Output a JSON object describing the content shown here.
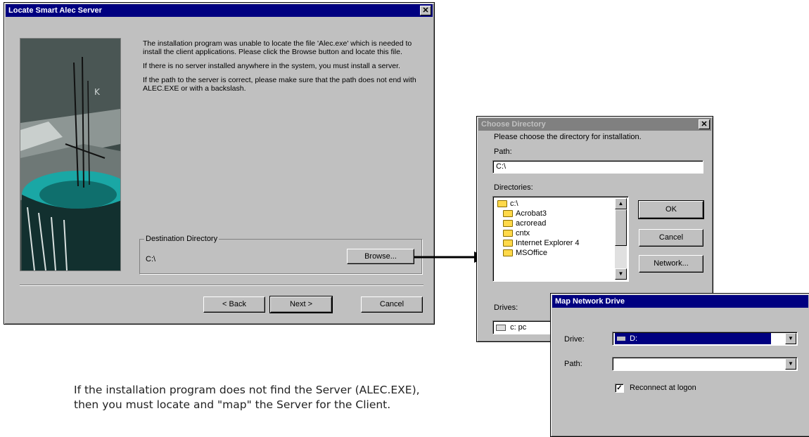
{
  "locate_dialog": {
    "title": "Locate Smart Alec Server",
    "paragraphs": [
      "The installation program was unable to locate the file 'Alec.exe' which is needed to install the client applications.  Please click the Browse button and locate this file.",
      "If there is no server installed anywhere in the system, you must install a server.",
      "If the path to the server is correct, please make sure that the path does not end with ALEC.EXE or with a backslash."
    ],
    "destination_group_label": "Destination Directory",
    "destination_value": "C:\\",
    "browse_label": "Browse...",
    "back_label": "< Back",
    "next_label": "Next >",
    "cancel_label": "Cancel"
  },
  "choose_dialog": {
    "title": "Choose Directory",
    "instruction": "Please choose the directory for installation.",
    "path_label": "Path:",
    "path_value": "C:\\",
    "directories_label": "Directories:",
    "directories": [
      "c:\\",
      "Acrobat3",
      "acroread",
      "cntx",
      "Internet Explorer 4",
      "MSOffice"
    ],
    "ok_label": "OK",
    "cancel_label": "Cancel",
    "network_label": "Network...",
    "drives_label": "Drives:",
    "drive_value": "c: pc"
  },
  "map_dialog": {
    "title": "Map Network Drive",
    "drive_label": "Drive:",
    "drive_value": "D:",
    "path_label": "Path:",
    "path_value": "",
    "reconnect_label": "Reconnect at logon",
    "reconnect_checked": true
  },
  "caption": {
    "line1": "If the installation program does not find the Server (ALEC.EXE),",
    "line2": "then you must locate and \"map\" the Server for the Client."
  }
}
